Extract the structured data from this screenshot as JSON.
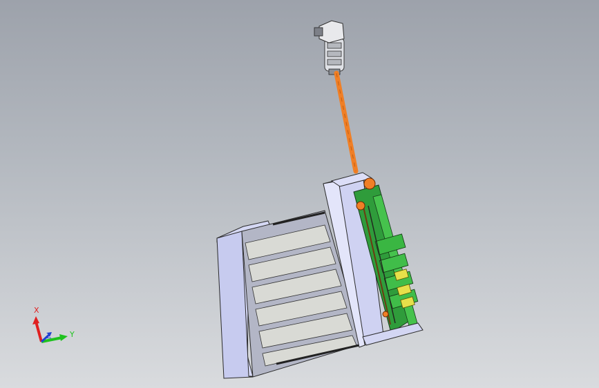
{
  "viewport": {
    "background_top": "#9da2ab",
    "background_bottom": "#d9dbde"
  },
  "model": {
    "shaft_color": "#f07f26",
    "housing_color": "#c9cdf0",
    "pcb_color": "#33b33a",
    "component_color": "#e6e04a"
  },
  "triad": {
    "x_label": "X",
    "y_label": "Y",
    "z_label": "Z",
    "x_color": "#e02020",
    "y_color": "#1fc21f",
    "z_color": "#2040d0"
  }
}
